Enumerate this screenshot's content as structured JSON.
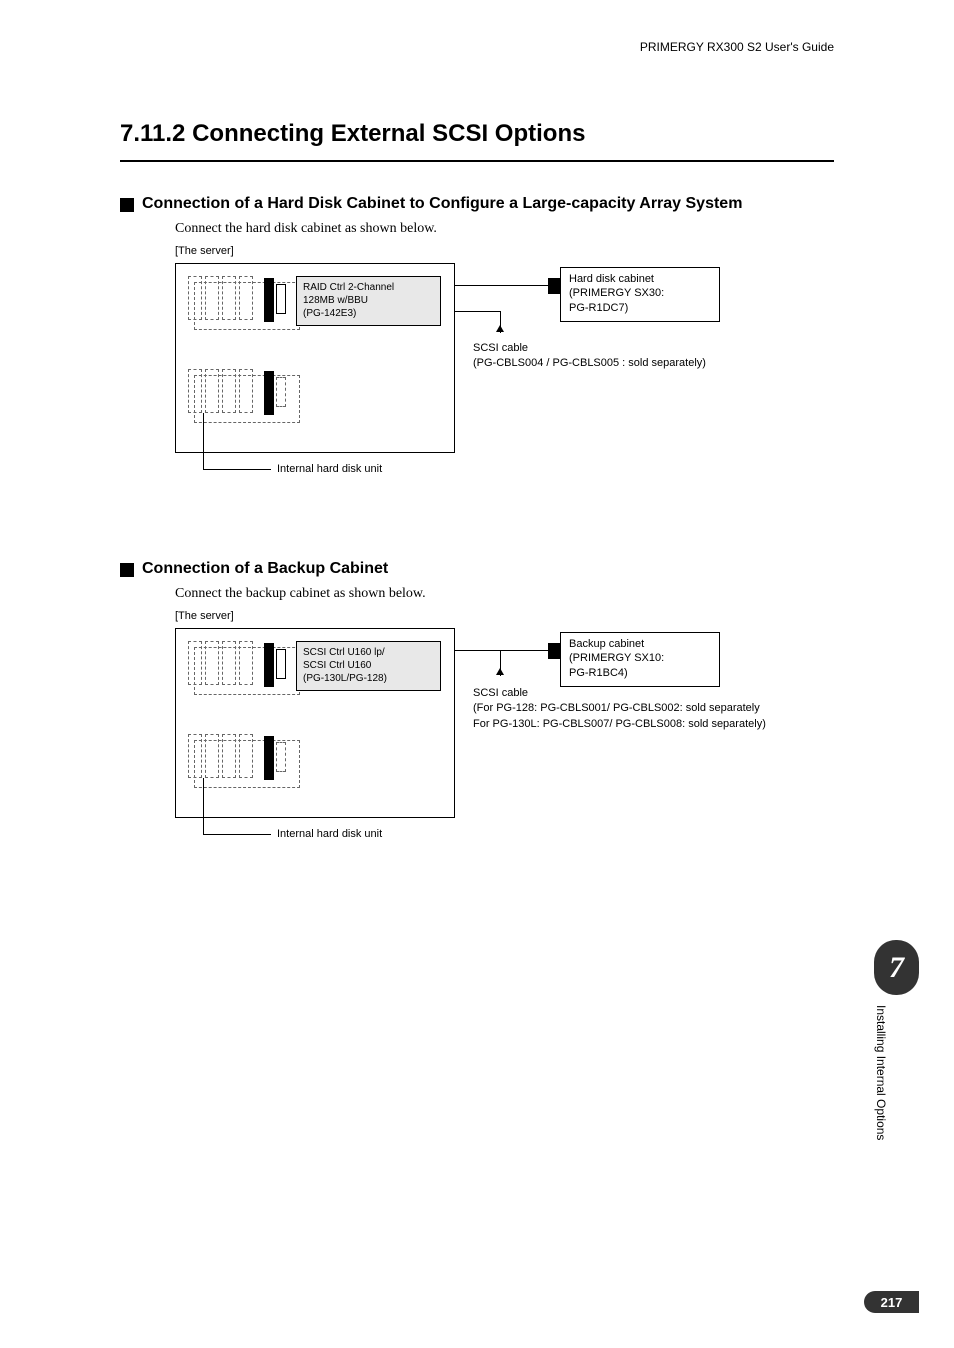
{
  "header": {
    "guide": "PRIMERGY RX300 S2 User's Guide"
  },
  "section": {
    "number": "7.11.2",
    "title": "Connecting External SCSI Options"
  },
  "sub1": {
    "title": "Connection of a Hard Disk Cabinet to Configure a Large-capacity Array System",
    "body": "Connect the hard disk cabinet as shown below.",
    "serverLabel": "[The server]",
    "cardLine1": "RAID Ctrl 2-Channel",
    "cardLine2": "128MB w/BBU",
    "cardLine3": "(PG-142E3)",
    "cabinetLine1": "Hard disk cabinet",
    "cabinetLine2": "(PRIMERGY SX30:",
    "cabinetLine3": " PG-R1DC7)",
    "cableLine1": "SCSI cable",
    "cableLine2": "(PG-CBLS004 / PG-CBLS005 : sold separately)",
    "hdu": "Internal hard disk unit"
  },
  "sub2": {
    "title": "Connection of a Backup Cabinet",
    "body": "Connect the backup cabinet as shown below.",
    "serverLabel": "[The server]",
    "cardLine1": "SCSI Ctrl U160 lp/",
    "cardLine2": "SCSI Ctrl U160",
    "cardLine3": "(PG-130L/PG-128)",
    "cabinetLine1": "Backup cabinet",
    "cabinetLine2": "(PRIMERGY SX10:",
    "cabinetLine3": " PG-R1BC4)",
    "cableLine1": "SCSI cable",
    "cableLine2": "(For PG-128: PG-CBLS001/ PG-CBLS002: sold separately",
    "cableLine3": " For PG-130L: PG-CBLS007/ PG-CBLS008: sold separately)",
    "hdu": "Internal hard disk unit"
  },
  "side": {
    "chapter": "7",
    "label": "Installing Internal Options"
  },
  "page": "217"
}
